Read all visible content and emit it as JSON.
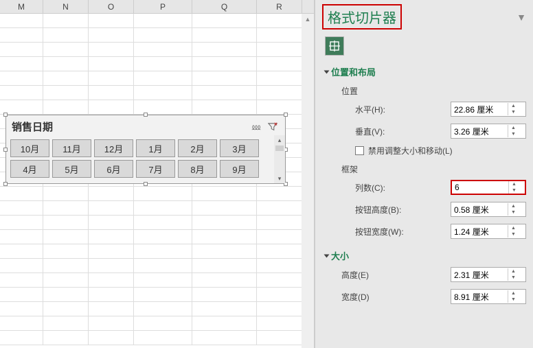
{
  "columns": [
    "M",
    "N",
    "O",
    "P",
    "Q",
    "R"
  ],
  "slicer": {
    "title": "销售日期",
    "buttons": [
      "10月",
      "11月",
      "12月",
      "1月",
      "2月",
      "3月",
      "4月",
      "5月",
      "6月",
      "7月",
      "8月",
      "9月"
    ]
  },
  "pane": {
    "title": "格式切片器",
    "sections": {
      "posLayout": "位置和布局",
      "size": "大小"
    },
    "groups": {
      "position": "位置",
      "frame": "框架"
    },
    "fields": {
      "horizontal": {
        "label": "水平(H):",
        "value": "22.86 厘米"
      },
      "vertical": {
        "label": "垂直(V):",
        "value": "3.26 厘米"
      },
      "lock": {
        "label": "禁用调整大小和移动(L)"
      },
      "columns": {
        "label": "列数(C):",
        "value": "6"
      },
      "btnHeight": {
        "label": "按钮高度(B):",
        "value": "0.58 厘米"
      },
      "btnWidth": {
        "label": "按钮宽度(W):",
        "value": "1.24 厘米"
      },
      "height": {
        "label": "高度(E)",
        "value": "2.31 厘米"
      },
      "width": {
        "label": "宽度(D)",
        "value": "8.91 厘米"
      }
    }
  }
}
